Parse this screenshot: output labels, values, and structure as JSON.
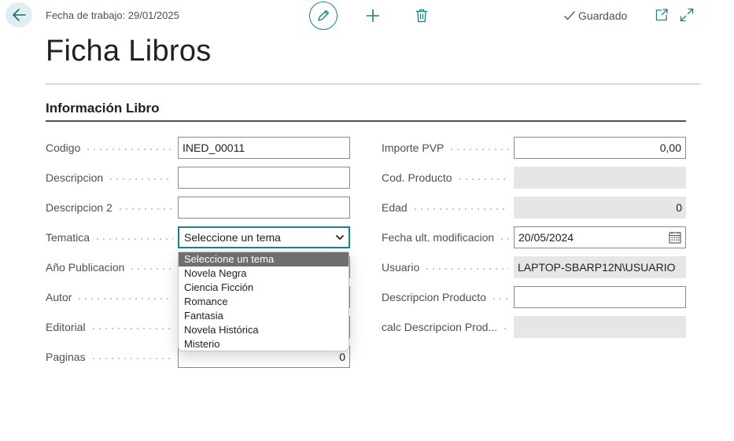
{
  "header": {
    "work_date": "Fecha de trabajo: 29/01/2025",
    "saved_status": "Guardado"
  },
  "page_title": "Ficha Libros",
  "section_title": "Información Libro",
  "left_fields": [
    {
      "label": "Codigo",
      "value": "INED_00011"
    },
    {
      "label": "Descripcion",
      "value": ""
    },
    {
      "label": "Descripcion 2",
      "value": ""
    },
    {
      "label": "Tematica",
      "value": "Seleccione un tema"
    },
    {
      "label": "Año Publicacion",
      "value": ""
    },
    {
      "label": "Autor",
      "value": ""
    },
    {
      "label": "Editorial",
      "value": ""
    },
    {
      "label": "Paginas",
      "value": "0"
    }
  ],
  "right_fields": [
    {
      "label": "Importe PVP",
      "value": "0,00"
    },
    {
      "label": "Cod. Producto",
      "value": ""
    },
    {
      "label": "Edad",
      "value": "0"
    },
    {
      "label": "Fecha ult. modificacion",
      "value": "20/05/2024"
    },
    {
      "label": "Usuario",
      "value": "LAPTOP-SBARP12N\\USUARIO"
    },
    {
      "label": "Descripcion Producto",
      "value": ""
    },
    {
      "label": "calc Descripcion Prod...",
      "value": ""
    }
  ],
  "tematica_options": [
    "Seleccione un tema",
    "Novela Negra",
    "Ciencia Ficción",
    "Romance",
    "Fantasia",
    "Novela Histórica",
    "Misterio"
  ],
  "colors": {
    "accent": "#1a8287",
    "readonly_bg": "#e6e6e6",
    "selected_option_bg": "#6e6e6e"
  },
  "icons": [
    "back-arrow-icon",
    "pencil-icon",
    "plus-icon",
    "trash-icon",
    "checkmark-icon",
    "popout-icon",
    "expand-icon",
    "chevron-down-icon",
    "calendar-icon"
  ]
}
